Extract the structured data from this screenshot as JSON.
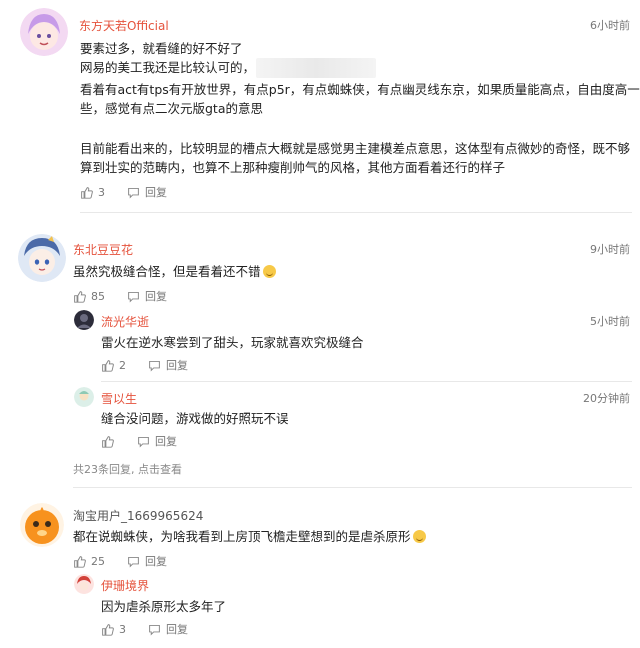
{
  "comments": [
    {
      "user": "东方天若Official",
      "time": "6小时前",
      "lines": [
        "要素过多，就看缝的好不好了",
        "网易的美工我还是比较认可的，",
        "看着有act有tps有开放世界，有点p5r，有点蜘蛛侠，有点幽灵线东京，如果质量能高点，自由度高一",
        "些，感觉有点二次元版gta的意思",
        "目前能看出来的，比较明显的槽点大概就是感觉男主建模差点意思，这体型有点微妙的奇怪，既不够",
        "算到壮实的范畴内，也算不上那种瘦削帅气的风格，其他方面看着还行的样子"
      ],
      "likes": "3",
      "reply_label": "回复"
    },
    {
      "user": "东北豆豆花",
      "time": "9小时前",
      "text": "虽然究极缝合怪，但是看着还不错",
      "likes": "85",
      "reply_label": "回复",
      "replies": [
        {
          "user": "流光华逝",
          "time": "5小时前",
          "text": "雷火在逆水寒尝到了甜头，玩家就喜欢究极缝合",
          "likes": "2",
          "reply_label": "回复"
        },
        {
          "user": "雪以生",
          "time": "20分钟前",
          "text": "缝合没问题，游戏做的好照玩不误",
          "likes": "",
          "reply_label": "回复"
        }
      ],
      "more_replies": "共23条回复, 点击查看"
    },
    {
      "user": "淘宝用户_1669965624",
      "time": "",
      "text": "都在说蜘蛛侠，为啥我看到上房顶飞檐走壁想到的是虐杀原形",
      "likes": "25",
      "reply_label": "回复",
      "replies": [
        {
          "user": "伊珊境界",
          "time": "",
          "text": "因为虐杀原形太多年了",
          "likes": "3",
          "reply_label": "回复"
        }
      ]
    }
  ],
  "colors": {
    "username": "#e5533d",
    "meta": "#777777",
    "divider": "#e8e8e8"
  },
  "icons": {
    "like": "thumbs-up-icon",
    "reply": "reply-bubble-icon"
  }
}
